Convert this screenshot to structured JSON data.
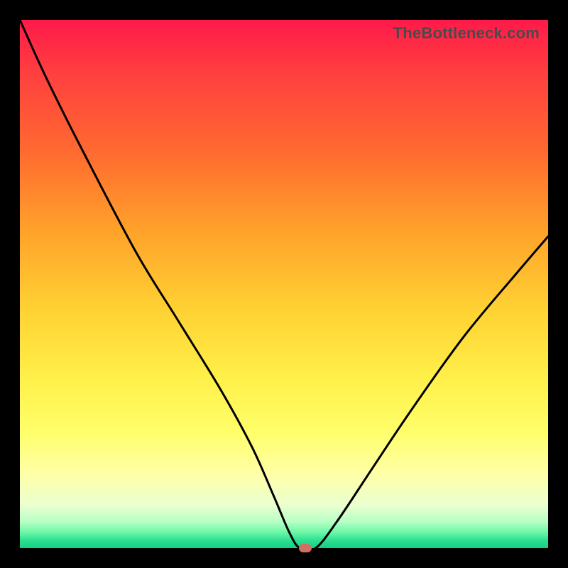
{
  "watermark": "TheBottleneck.com",
  "chart_data": {
    "type": "line",
    "title": "",
    "xlabel": "",
    "ylabel": "",
    "xlim": [
      0,
      100
    ],
    "ylim": [
      0,
      100
    ],
    "grid": false,
    "series": [
      {
        "name": "bottleneck-curve",
        "x": [
          0,
          5,
          12,
          22,
          30,
          38,
          44,
          48,
          51,
          53,
          56,
          60,
          66,
          74,
          84,
          94,
          100
        ],
        "values": [
          100,
          89,
          75,
          56,
          43,
          30,
          19,
          10,
          3,
          0,
          0,
          5,
          14,
          26,
          40,
          52,
          59
        ]
      }
    ],
    "marker": {
      "x": 54,
      "y": 0,
      "color": "#d07062"
    },
    "gradient_stops": [
      {
        "pos": 0,
        "color": "#ff1a4a"
      },
      {
        "pos": 0.55,
        "color": "#ffd233"
      },
      {
        "pos": 0.86,
        "color": "#ffffa8"
      },
      {
        "pos": 1.0,
        "color": "#11d084"
      }
    ]
  }
}
